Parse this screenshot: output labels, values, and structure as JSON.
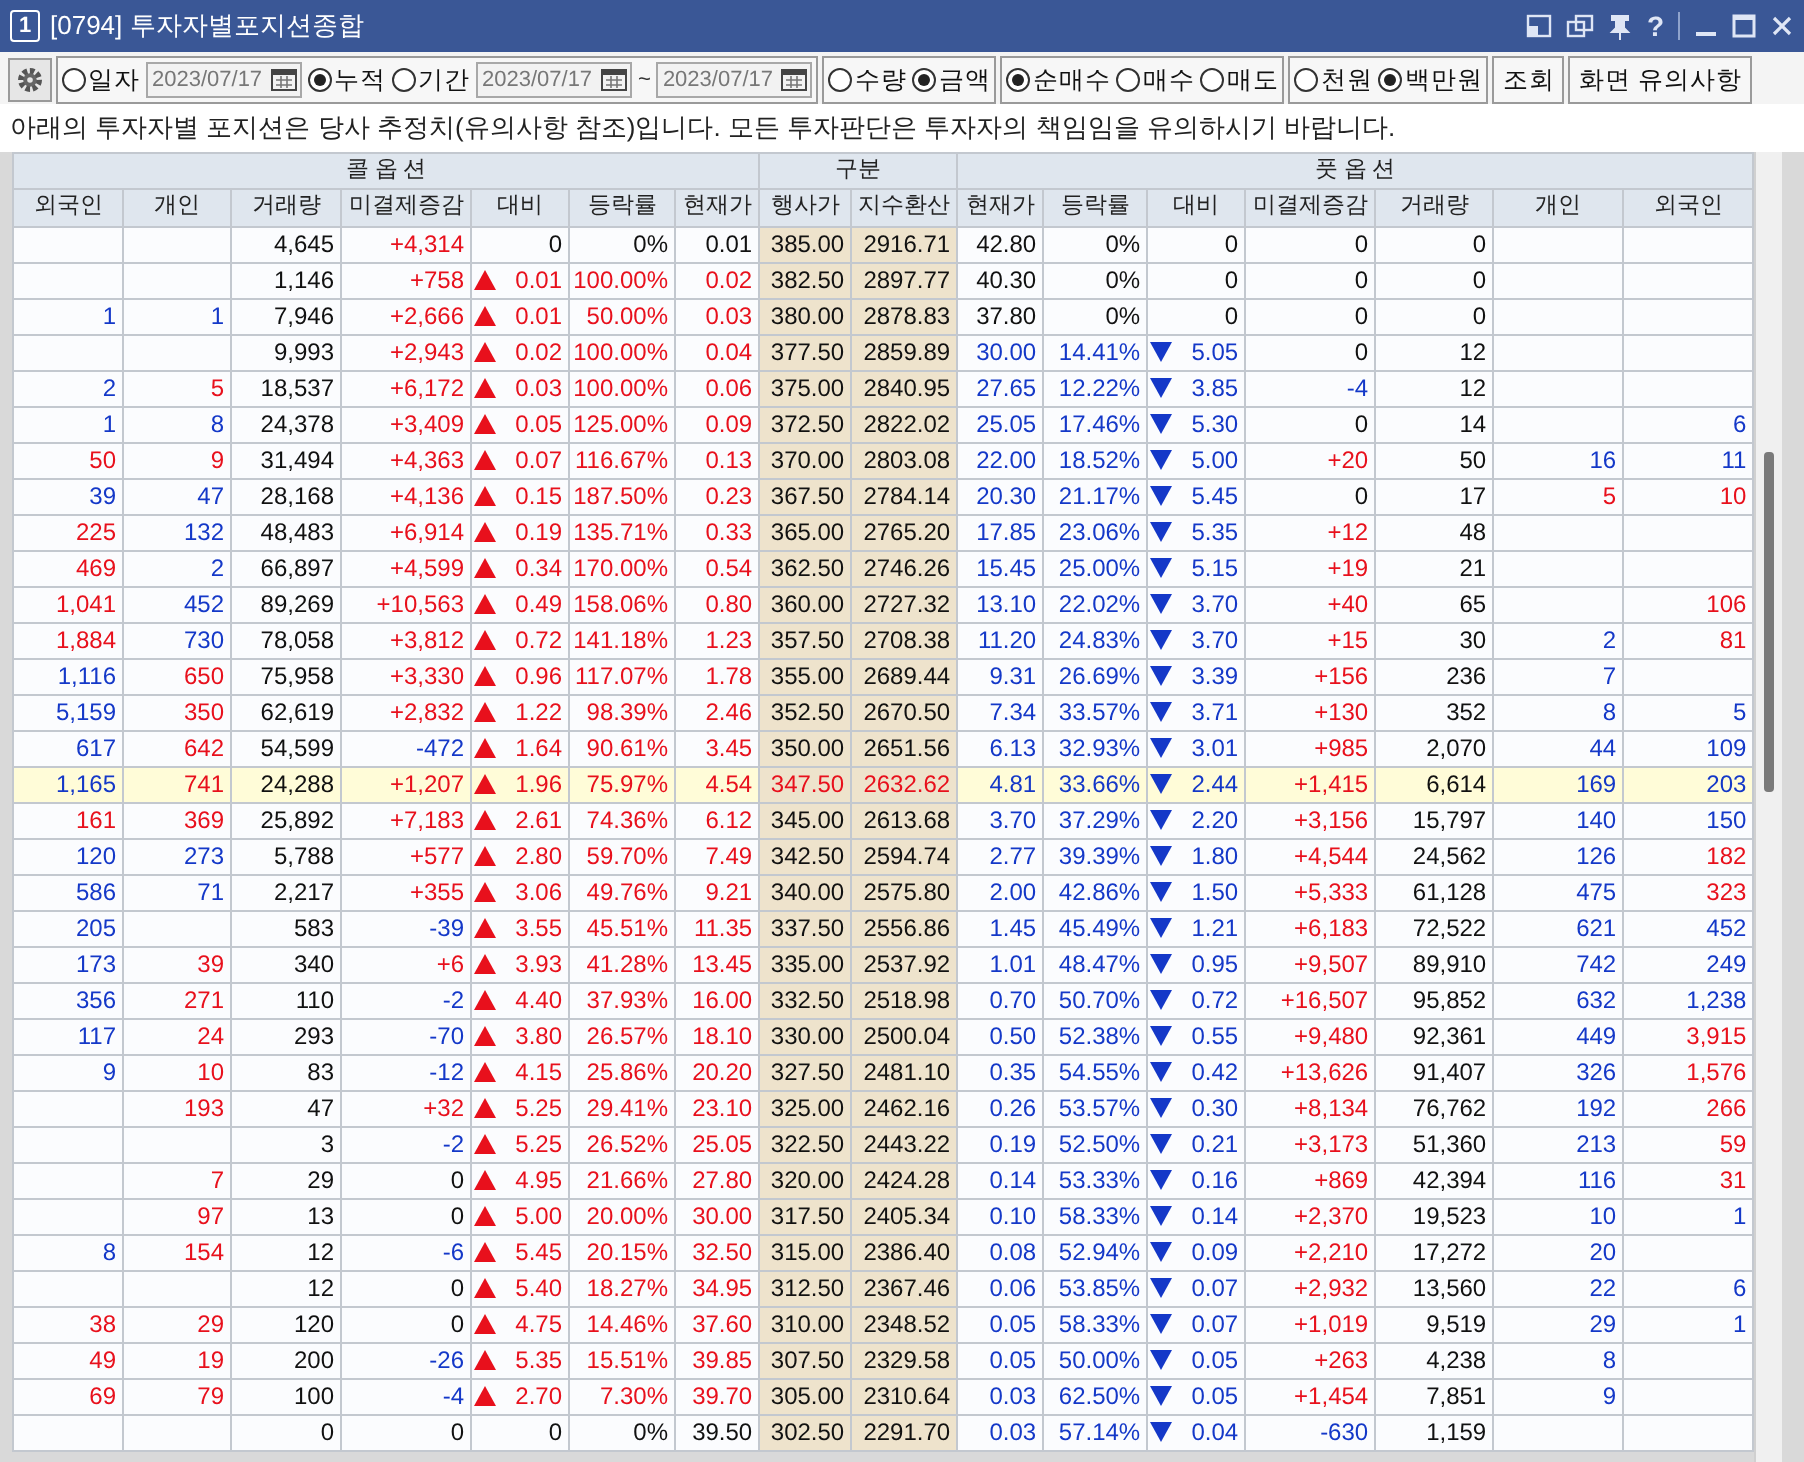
{
  "window": {
    "number": "1",
    "title": "[0794] 투자자별포지션종합",
    "help": "?"
  },
  "toolbar": {
    "date_mode": [
      {
        "label": "일자",
        "selected": false,
        "kind": "single",
        "date": "2023/07/17"
      },
      {
        "label": "누적",
        "selected": true,
        "kind": "plain"
      },
      {
        "label": "기간",
        "selected": false,
        "kind": "range",
        "date_from": "2023/07/17",
        "separator": "~",
        "date_to": "2023/07/17"
      }
    ],
    "unit_type": [
      {
        "label": "수량",
        "selected": false
      },
      {
        "label": "금액",
        "selected": true
      }
    ],
    "trade_type": [
      {
        "label": "순매수",
        "selected": true
      },
      {
        "label": "매수",
        "selected": false
      },
      {
        "label": "매도",
        "selected": false
      }
    ],
    "currency_unit": [
      {
        "label": "천원",
        "selected": false
      },
      {
        "label": "백만원",
        "selected": true
      }
    ],
    "buttons": [
      "조회",
      "화면 유의사항"
    ]
  },
  "notice": "아래의 투자자별 포지션은 당사 추정치(유의사항 참조)입니다. 모든 투자판단은 투자자의 책임임을 유의하시기 바랍니다.",
  "table": {
    "groups": [
      {
        "label": "콜 옵 션",
        "kind": "call",
        "columns": [
          {
            "label": "외국인",
            "kind": "investor"
          },
          {
            "label": "개인",
            "kind": "investor"
          },
          {
            "label": "거래량",
            "kind": "volume"
          },
          {
            "label": "미결제증감",
            "kind": "oi"
          },
          {
            "label": "대비",
            "kind": "change"
          },
          {
            "label": "등락률",
            "kind": "rate"
          },
          {
            "label": "현재가",
            "kind": "price"
          }
        ]
      },
      {
        "label": "구분",
        "kind": "strike",
        "columns": [
          {
            "label": "행사가",
            "kind": "strike"
          },
          {
            "label": "지수환산",
            "kind": "index"
          }
        ]
      },
      {
        "label": "풋 옵 션",
        "kind": "put",
        "columns": [
          {
            "label": "현재가",
            "kind": "price"
          },
          {
            "label": "등락률",
            "kind": "rate"
          },
          {
            "label": "대비",
            "kind": "change"
          },
          {
            "label": "미결제증감",
            "kind": "oi"
          },
          {
            "label": "거래량",
            "kind": "volume"
          },
          {
            "label": "개인",
            "kind": "investor"
          },
          {
            "label": "외국인",
            "kind": "investor"
          }
        ]
      }
    ],
    "rows": [
      {
        "highlighted": false,
        "cells": [
          "",
          "",
          "4,645",
          "+4,314",
          "0",
          "0%",
          "0.01",
          "385.00",
          "2916.71",
          "42.80",
          "0%",
          "0",
          "0",
          "0",
          "",
          ""
        ],
        "rising": [
          false,
          false,
          false,
          true,
          false,
          false,
          false,
          false,
          false,
          false,
          false,
          false,
          false,
          false,
          false,
          false
        ],
        "falling": [
          false,
          false,
          false,
          false,
          false,
          false,
          false,
          false,
          false,
          false,
          false,
          false,
          false,
          false,
          false,
          false
        ]
      },
      {
        "highlighted": false,
        "cells": [
          "",
          "",
          "1,146",
          "+758",
          "0.01",
          "100.00%",
          "0.02",
          "382.50",
          "2897.77",
          "40.30",
          "0%",
          "0",
          "0",
          "0",
          "",
          ""
        ],
        "rising": [
          false,
          false,
          false,
          true,
          true,
          true,
          true,
          false,
          false,
          false,
          false,
          false,
          false,
          false,
          false,
          false
        ],
        "falling": [
          false,
          false,
          false,
          false,
          false,
          false,
          false,
          false,
          false,
          false,
          false,
          false,
          false,
          false,
          false,
          false
        ]
      },
      {
        "highlighted": false,
        "cells": [
          "1",
          "1",
          "7,946",
          "+2,666",
          "0.01",
          "50.00%",
          "0.03",
          "380.00",
          "2878.83",
          "37.80",
          "0%",
          "0",
          "0",
          "0",
          "",
          ""
        ],
        "rising": [
          false,
          false,
          false,
          true,
          true,
          true,
          true,
          false,
          false,
          false,
          false,
          false,
          false,
          false,
          false,
          false
        ],
        "falling": [
          true,
          true,
          false,
          false,
          false,
          false,
          false,
          false,
          false,
          false,
          false,
          false,
          false,
          false,
          false,
          false
        ]
      },
      {
        "highlighted": false,
        "cells": [
          "",
          "",
          "9,993",
          "+2,943",
          "0.02",
          "100.00%",
          "0.04",
          "377.50",
          "2859.89",
          "30.00",
          "14.41%",
          "5.05",
          "0",
          "12",
          "",
          ""
        ],
        "rising": [
          false,
          false,
          false,
          true,
          true,
          true,
          true,
          false,
          false,
          false,
          false,
          false,
          false,
          false,
          false,
          false
        ],
        "falling": [
          false,
          false,
          false,
          false,
          false,
          false,
          false,
          false,
          false,
          true,
          true,
          true,
          false,
          false,
          false,
          false
        ]
      },
      {
        "highlighted": false,
        "cells": [
          "2",
          "5",
          "18,537",
          "+6,172",
          "0.03",
          "100.00%",
          "0.06",
          "375.00",
          "2840.95",
          "27.65",
          "12.22%",
          "3.85",
          "-4",
          "12",
          "",
          ""
        ],
        "rising": [
          false,
          true,
          false,
          true,
          true,
          true,
          true,
          false,
          false,
          false,
          false,
          false,
          false,
          false,
          false,
          false
        ],
        "falling": [
          true,
          false,
          false,
          false,
          false,
          false,
          false,
          false,
          false,
          true,
          true,
          true,
          true,
          false,
          false,
          false
        ]
      },
      {
        "highlighted": false,
        "cells": [
          "1",
          "8",
          "24,378",
          "+3,409",
          "0.05",
          "125.00%",
          "0.09",
          "372.50",
          "2822.02",
          "25.05",
          "17.46%",
          "5.30",
          "0",
          "14",
          "",
          "6"
        ],
        "rising": [
          false,
          false,
          false,
          true,
          true,
          true,
          true,
          false,
          false,
          false,
          false,
          false,
          false,
          false,
          false,
          false
        ],
        "falling": [
          true,
          true,
          false,
          false,
          false,
          false,
          false,
          false,
          false,
          true,
          true,
          true,
          false,
          false,
          false,
          true
        ]
      },
      {
        "highlighted": false,
        "cells": [
          "50",
          "9",
          "31,494",
          "+4,363",
          "0.07",
          "116.67%",
          "0.13",
          "370.00",
          "2803.08",
          "22.00",
          "18.52%",
          "5.00",
          "+20",
          "50",
          "16",
          "11"
        ],
        "rising": [
          true,
          true,
          false,
          true,
          true,
          true,
          true,
          false,
          false,
          false,
          false,
          false,
          true,
          false,
          false,
          false
        ],
        "falling": [
          false,
          false,
          false,
          false,
          false,
          false,
          false,
          false,
          false,
          true,
          true,
          true,
          false,
          false,
          true,
          true
        ]
      },
      {
        "highlighted": false,
        "cells": [
          "39",
          "47",
          "28,168",
          "+4,136",
          "0.15",
          "187.50%",
          "0.23",
          "367.50",
          "2784.14",
          "20.30",
          "21.17%",
          "5.45",
          "0",
          "17",
          "5",
          "10"
        ],
        "rising": [
          false,
          false,
          false,
          true,
          true,
          true,
          true,
          false,
          false,
          false,
          false,
          false,
          false,
          false,
          true,
          true
        ],
        "falling": [
          true,
          true,
          false,
          false,
          false,
          false,
          false,
          false,
          false,
          true,
          true,
          true,
          false,
          false,
          false,
          false
        ]
      },
      {
        "highlighted": false,
        "cells": [
          "225",
          "132",
          "48,483",
          "+6,914",
          "0.19",
          "135.71%",
          "0.33",
          "365.00",
          "2765.20",
          "17.85",
          "23.06%",
          "5.35",
          "+12",
          "48",
          "",
          ""
        ],
        "rising": [
          true,
          false,
          false,
          true,
          true,
          true,
          true,
          false,
          false,
          false,
          false,
          false,
          true,
          false,
          false,
          false
        ],
        "falling": [
          false,
          true,
          false,
          false,
          false,
          false,
          false,
          false,
          false,
          true,
          true,
          true,
          false,
          false,
          false,
          false
        ]
      },
      {
        "highlighted": false,
        "cells": [
          "469",
          "2",
          "66,897",
          "+4,599",
          "0.34",
          "170.00%",
          "0.54",
          "362.50",
          "2746.26",
          "15.45",
          "25.00%",
          "5.15",
          "+19",
          "21",
          "",
          ""
        ],
        "rising": [
          true,
          false,
          false,
          true,
          true,
          true,
          true,
          false,
          false,
          false,
          false,
          false,
          true,
          false,
          false,
          false
        ],
        "falling": [
          false,
          true,
          false,
          false,
          false,
          false,
          false,
          false,
          false,
          true,
          true,
          true,
          false,
          false,
          false,
          false
        ]
      },
      {
        "highlighted": false,
        "cells": [
          "1,041",
          "452",
          "89,269",
          "+10,563",
          "0.49",
          "158.06%",
          "0.80",
          "360.00",
          "2727.32",
          "13.10",
          "22.02%",
          "3.70",
          "+40",
          "65",
          "",
          "106"
        ],
        "rising": [
          true,
          false,
          false,
          true,
          true,
          true,
          true,
          false,
          false,
          false,
          false,
          false,
          true,
          false,
          false,
          true
        ],
        "falling": [
          false,
          true,
          false,
          false,
          false,
          false,
          false,
          false,
          false,
          true,
          true,
          true,
          false,
          false,
          false,
          false
        ]
      },
      {
        "highlighted": false,
        "cells": [
          "1,884",
          "730",
          "78,058",
          "+3,812",
          "0.72",
          "141.18%",
          "1.23",
          "357.50",
          "2708.38",
          "11.20",
          "24.83%",
          "3.70",
          "+15",
          "30",
          "2",
          "81"
        ],
        "rising": [
          true,
          false,
          false,
          true,
          true,
          true,
          true,
          false,
          false,
          false,
          false,
          false,
          true,
          false,
          false,
          true
        ],
        "falling": [
          false,
          true,
          false,
          false,
          false,
          false,
          false,
          false,
          false,
          true,
          true,
          true,
          false,
          false,
          true,
          false
        ]
      },
      {
        "highlighted": false,
        "cells": [
          "1,116",
          "650",
          "75,958",
          "+3,330",
          "0.96",
          "117.07%",
          "1.78",
          "355.00",
          "2689.44",
          "9.31",
          "26.69%",
          "3.39",
          "+156",
          "236",
          "7",
          ""
        ],
        "rising": [
          false,
          true,
          false,
          true,
          true,
          true,
          true,
          false,
          false,
          false,
          false,
          false,
          true,
          false,
          false,
          false
        ],
        "falling": [
          true,
          false,
          false,
          false,
          false,
          false,
          false,
          false,
          false,
          true,
          true,
          true,
          false,
          false,
          true,
          false
        ]
      },
      {
        "highlighted": false,
        "cells": [
          "5,159",
          "350",
          "62,619",
          "+2,832",
          "1.22",
          "98.39%",
          "2.46",
          "352.50",
          "2670.50",
          "7.34",
          "33.57%",
          "3.71",
          "+130",
          "352",
          "8",
          "5"
        ],
        "rising": [
          false,
          true,
          false,
          true,
          true,
          true,
          true,
          false,
          false,
          false,
          false,
          false,
          true,
          false,
          false,
          false
        ],
        "falling": [
          true,
          false,
          false,
          false,
          false,
          false,
          false,
          false,
          false,
          true,
          true,
          true,
          false,
          false,
          true,
          true
        ]
      },
      {
        "highlighted": false,
        "cells": [
          "617",
          "642",
          "54,599",
          "-472",
          "1.64",
          "90.61%",
          "3.45",
          "350.00",
          "2651.56",
          "6.13",
          "32.93%",
          "3.01",
          "+985",
          "2,070",
          "44",
          "109"
        ],
        "rising": [
          false,
          true,
          false,
          false,
          true,
          true,
          true,
          false,
          false,
          false,
          false,
          false,
          true,
          false,
          false,
          false
        ],
        "falling": [
          true,
          false,
          false,
          true,
          false,
          false,
          false,
          false,
          false,
          true,
          true,
          true,
          false,
          false,
          true,
          true
        ]
      },
      {
        "highlighted": true,
        "cells": [
          "1,165",
          "741",
          "24,288",
          "+1,207",
          "1.96",
          "75.97%",
          "4.54",
          "347.50",
          "2632.62",
          "4.81",
          "33.66%",
          "2.44",
          "+1,415",
          "6,614",
          "169",
          "203"
        ],
        "rising": [
          false,
          true,
          false,
          true,
          true,
          true,
          true,
          true,
          true,
          false,
          false,
          false,
          true,
          false,
          false,
          false
        ],
        "falling": [
          true,
          false,
          false,
          false,
          false,
          false,
          false,
          false,
          false,
          true,
          true,
          true,
          false,
          false,
          true,
          true
        ]
      },
      {
        "highlighted": false,
        "cells": [
          "161",
          "369",
          "25,892",
          "+7,183",
          "2.61",
          "74.36%",
          "6.12",
          "345.00",
          "2613.68",
          "3.70",
          "37.29%",
          "2.20",
          "+3,156",
          "15,797",
          "140",
          "150"
        ],
        "rising": [
          true,
          true,
          false,
          true,
          true,
          true,
          true,
          false,
          false,
          false,
          false,
          false,
          true,
          false,
          false,
          false
        ],
        "falling": [
          false,
          false,
          false,
          false,
          false,
          false,
          false,
          false,
          false,
          true,
          true,
          true,
          false,
          false,
          true,
          true
        ]
      },
      {
        "highlighted": false,
        "cells": [
          "120",
          "273",
          "5,788",
          "+577",
          "2.80",
          "59.70%",
          "7.49",
          "342.50",
          "2594.74",
          "2.77",
          "39.39%",
          "1.80",
          "+4,544",
          "24,562",
          "126",
          "182"
        ],
        "rising": [
          false,
          false,
          false,
          true,
          true,
          true,
          true,
          false,
          false,
          false,
          false,
          false,
          true,
          false,
          false,
          true
        ],
        "falling": [
          true,
          true,
          false,
          false,
          false,
          false,
          false,
          false,
          false,
          true,
          true,
          true,
          false,
          false,
          true,
          false
        ]
      },
      {
        "highlighted": false,
        "cells": [
          "586",
          "71",
          "2,217",
          "+355",
          "3.06",
          "49.76%",
          "9.21",
          "340.00",
          "2575.80",
          "2.00",
          "42.86%",
          "1.50",
          "+5,333",
          "61,128",
          "475",
          "323"
        ],
        "rising": [
          false,
          false,
          false,
          true,
          true,
          true,
          true,
          false,
          false,
          false,
          false,
          false,
          true,
          false,
          false,
          true
        ],
        "falling": [
          true,
          true,
          false,
          false,
          false,
          false,
          false,
          false,
          false,
          true,
          true,
          true,
          false,
          false,
          true,
          false
        ]
      },
      {
        "highlighted": false,
        "cells": [
          "205",
          "",
          "583",
          "-39",
          "3.55",
          "45.51%",
          "11.35",
          "337.50",
          "2556.86",
          "1.45",
          "45.49%",
          "1.21",
          "+6,183",
          "72,522",
          "621",
          "452"
        ],
        "rising": [
          false,
          false,
          false,
          false,
          true,
          true,
          true,
          false,
          false,
          false,
          false,
          false,
          true,
          false,
          false,
          false
        ],
        "falling": [
          true,
          false,
          false,
          true,
          false,
          false,
          false,
          false,
          false,
          true,
          true,
          true,
          false,
          false,
          true,
          true
        ]
      },
      {
        "highlighted": false,
        "cells": [
          "173",
          "39",
          "340",
          "+6",
          "3.93",
          "41.28%",
          "13.45",
          "335.00",
          "2537.92",
          "1.01",
          "48.47%",
          "0.95",
          "+9,507",
          "89,910",
          "742",
          "249"
        ],
        "rising": [
          false,
          true,
          false,
          true,
          true,
          true,
          true,
          false,
          false,
          false,
          false,
          false,
          true,
          false,
          false,
          false
        ],
        "falling": [
          true,
          false,
          false,
          false,
          false,
          false,
          false,
          false,
          false,
          true,
          true,
          true,
          false,
          false,
          true,
          true
        ]
      },
      {
        "highlighted": false,
        "cells": [
          "356",
          "271",
          "110",
          "-2",
          "4.40",
          "37.93%",
          "16.00",
          "332.50",
          "2518.98",
          "0.70",
          "50.70%",
          "0.72",
          "+16,507",
          "95,852",
          "632",
          "1,238"
        ],
        "rising": [
          false,
          true,
          false,
          false,
          true,
          true,
          true,
          false,
          false,
          false,
          false,
          false,
          true,
          false,
          false,
          false
        ],
        "falling": [
          true,
          false,
          false,
          true,
          false,
          false,
          false,
          false,
          false,
          true,
          true,
          true,
          false,
          false,
          true,
          true
        ]
      },
      {
        "highlighted": false,
        "cells": [
          "117",
          "24",
          "293",
          "-70",
          "3.80",
          "26.57%",
          "18.10",
          "330.00",
          "2500.04",
          "0.50",
          "52.38%",
          "0.55",
          "+9,480",
          "92,361",
          "449",
          "3,915"
        ],
        "rising": [
          false,
          true,
          false,
          false,
          true,
          true,
          true,
          false,
          false,
          false,
          false,
          false,
          true,
          false,
          false,
          true
        ],
        "falling": [
          true,
          false,
          false,
          true,
          false,
          false,
          false,
          false,
          false,
          true,
          true,
          true,
          false,
          false,
          true,
          false
        ]
      },
      {
        "highlighted": false,
        "cells": [
          "9",
          "10",
          "83",
          "-12",
          "4.15",
          "25.86%",
          "20.20",
          "327.50",
          "2481.10",
          "0.35",
          "54.55%",
          "0.42",
          "+13,626",
          "91,407",
          "326",
          "1,576"
        ],
        "rising": [
          false,
          true,
          false,
          false,
          true,
          true,
          true,
          false,
          false,
          false,
          false,
          false,
          true,
          false,
          false,
          true
        ],
        "falling": [
          true,
          false,
          false,
          true,
          false,
          false,
          false,
          false,
          false,
          true,
          true,
          true,
          false,
          false,
          true,
          false
        ]
      },
      {
        "highlighted": false,
        "cells": [
          "",
          "193",
          "47",
          "+32",
          "5.25",
          "29.41%",
          "23.10",
          "325.00",
          "2462.16",
          "0.26",
          "53.57%",
          "0.30",
          "+8,134",
          "76,762",
          "192",
          "266"
        ],
        "rising": [
          false,
          true,
          false,
          true,
          true,
          true,
          true,
          false,
          false,
          false,
          false,
          false,
          true,
          false,
          false,
          true
        ],
        "falling": [
          false,
          false,
          false,
          false,
          false,
          false,
          false,
          false,
          false,
          true,
          true,
          true,
          false,
          false,
          true,
          false
        ]
      },
      {
        "highlighted": false,
        "cells": [
          "",
          "",
          "3",
          "-2",
          "5.25",
          "26.52%",
          "25.05",
          "322.50",
          "2443.22",
          "0.19",
          "52.50%",
          "0.21",
          "+3,173",
          "51,360",
          "213",
          "59"
        ],
        "rising": [
          false,
          false,
          false,
          false,
          true,
          true,
          true,
          false,
          false,
          false,
          false,
          false,
          true,
          false,
          false,
          true
        ],
        "falling": [
          false,
          false,
          false,
          true,
          false,
          false,
          false,
          false,
          false,
          true,
          true,
          true,
          false,
          false,
          true,
          false
        ]
      },
      {
        "highlighted": false,
        "cells": [
          "",
          "7",
          "29",
          "0",
          "4.95",
          "21.66%",
          "27.80",
          "320.00",
          "2424.28",
          "0.14",
          "53.33%",
          "0.16",
          "+869",
          "42,394",
          "116",
          "31"
        ],
        "rising": [
          false,
          true,
          false,
          false,
          true,
          true,
          true,
          false,
          false,
          false,
          false,
          false,
          true,
          false,
          false,
          true
        ],
        "falling": [
          false,
          false,
          false,
          false,
          false,
          false,
          false,
          false,
          false,
          true,
          true,
          true,
          false,
          false,
          true,
          false
        ]
      },
      {
        "highlighted": false,
        "cells": [
          "",
          "97",
          "13",
          "0",
          "5.00",
          "20.00%",
          "30.00",
          "317.50",
          "2405.34",
          "0.10",
          "58.33%",
          "0.14",
          "+2,370",
          "19,523",
          "10",
          "1"
        ],
        "rising": [
          false,
          true,
          false,
          false,
          true,
          true,
          true,
          false,
          false,
          false,
          false,
          false,
          true,
          false,
          false,
          false
        ],
        "falling": [
          false,
          false,
          false,
          false,
          false,
          false,
          false,
          false,
          false,
          true,
          true,
          true,
          false,
          false,
          true,
          true
        ]
      },
      {
        "highlighted": false,
        "cells": [
          "8",
          "154",
          "12",
          "-6",
          "5.45",
          "20.15%",
          "32.50",
          "315.00",
          "2386.40",
          "0.08",
          "52.94%",
          "0.09",
          "+2,210",
          "17,272",
          "20",
          ""
        ],
        "rising": [
          false,
          true,
          false,
          false,
          true,
          true,
          true,
          false,
          false,
          false,
          false,
          false,
          true,
          false,
          false,
          false
        ],
        "falling": [
          true,
          false,
          false,
          true,
          false,
          false,
          false,
          false,
          false,
          true,
          true,
          true,
          false,
          false,
          true,
          false
        ]
      },
      {
        "highlighted": false,
        "cells": [
          "",
          "",
          "12",
          "0",
          "5.40",
          "18.27%",
          "34.95",
          "312.50",
          "2367.46",
          "0.06",
          "53.85%",
          "0.07",
          "+2,932",
          "13,560",
          "22",
          "6"
        ],
        "rising": [
          false,
          false,
          false,
          false,
          true,
          true,
          true,
          false,
          false,
          false,
          false,
          false,
          true,
          false,
          false,
          false
        ],
        "falling": [
          false,
          false,
          false,
          false,
          false,
          false,
          false,
          false,
          false,
          true,
          true,
          true,
          false,
          false,
          true,
          true
        ]
      },
      {
        "highlighted": false,
        "cells": [
          "38",
          "29",
          "120",
          "0",
          "4.75",
          "14.46%",
          "37.60",
          "310.00",
          "2348.52",
          "0.05",
          "58.33%",
          "0.07",
          "+1,019",
          "9,519",
          "29",
          "1"
        ],
        "rising": [
          true,
          true,
          false,
          false,
          true,
          true,
          true,
          false,
          false,
          false,
          false,
          false,
          true,
          false,
          false,
          false
        ],
        "falling": [
          false,
          false,
          false,
          false,
          false,
          false,
          false,
          false,
          false,
          true,
          true,
          true,
          false,
          false,
          true,
          true
        ]
      },
      {
        "highlighted": false,
        "cells": [
          "49",
          "19",
          "200",
          "-26",
          "5.35",
          "15.51%",
          "39.85",
          "307.50",
          "2329.58",
          "0.05",
          "50.00%",
          "0.05",
          "+263",
          "4,238",
          "8",
          ""
        ],
        "rising": [
          true,
          true,
          false,
          false,
          true,
          true,
          true,
          false,
          false,
          false,
          false,
          false,
          true,
          false,
          false,
          false
        ],
        "falling": [
          false,
          false,
          false,
          true,
          false,
          false,
          false,
          false,
          false,
          true,
          true,
          true,
          false,
          false,
          true,
          false
        ]
      },
      {
        "highlighted": false,
        "cells": [
          "69",
          "79",
          "100",
          "-4",
          "2.70",
          "7.30%",
          "39.70",
          "305.00",
          "2310.64",
          "0.03",
          "62.50%",
          "0.05",
          "+1,454",
          "7,851",
          "9",
          ""
        ],
        "rising": [
          true,
          true,
          false,
          false,
          true,
          true,
          true,
          false,
          false,
          false,
          false,
          false,
          true,
          false,
          false,
          false
        ],
        "falling": [
          false,
          false,
          false,
          true,
          false,
          false,
          false,
          false,
          false,
          true,
          true,
          true,
          false,
          false,
          true,
          false
        ]
      },
      {
        "highlighted": false,
        "cells": [
          "",
          "",
          "0",
          "0",
          "0",
          "0%",
          "39.50",
          "302.50",
          "2291.70",
          "0.03",
          "57.14%",
          "0.04",
          "-630",
          "1,159",
          "",
          ""
        ],
        "rising": [
          false,
          false,
          false,
          false,
          false,
          false,
          false,
          false,
          false,
          false,
          false,
          false,
          false,
          false,
          false,
          false
        ],
        "falling": [
          false,
          false,
          false,
          false,
          false,
          false,
          false,
          false,
          false,
          true,
          true,
          true,
          true,
          false,
          false,
          false
        ]
      }
    ]
  }
}
